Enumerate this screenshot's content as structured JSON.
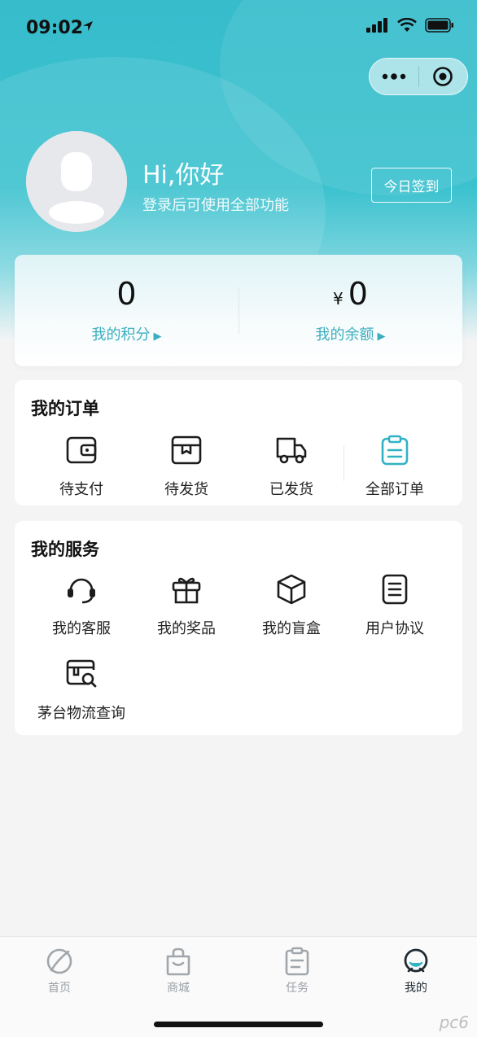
{
  "status_bar": {
    "time": "09:02"
  },
  "profile": {
    "greeting": "Hi,你好",
    "subtitle": "登录后可使用全部功能",
    "checkin_label": "今日签到"
  },
  "stats": {
    "points_value": "0",
    "points_label": "我的积分",
    "balance_currency": "¥",
    "balance_value": "0",
    "balance_label": "我的余额"
  },
  "orders": {
    "title": "我的订单",
    "items": [
      {
        "label": "待支付",
        "icon": "wallet-icon"
      },
      {
        "label": "待发货",
        "icon": "package-icon"
      },
      {
        "label": "已发货",
        "icon": "truck-icon"
      },
      {
        "label": "全部订单",
        "icon": "clipboard-icon"
      }
    ]
  },
  "services": {
    "title": "我的服务",
    "items": [
      {
        "label": "我的客服",
        "icon": "headset-icon"
      },
      {
        "label": "我的奖品",
        "icon": "gift-icon"
      },
      {
        "label": "我的盲盒",
        "icon": "box-icon"
      },
      {
        "label": "用户协议",
        "icon": "document-icon"
      },
      {
        "label": "茅台物流查询",
        "icon": "logistics-search-icon"
      }
    ]
  },
  "tabbar": {
    "tabs": [
      {
        "label": "首页",
        "icon": "home-icon"
      },
      {
        "label": "商城",
        "icon": "shopping-bag-icon"
      },
      {
        "label": "任务",
        "icon": "task-icon"
      },
      {
        "label": "我的",
        "icon": "profile-icon",
        "active": true
      }
    ]
  },
  "watermark": "pc6",
  "colors": {
    "accent": "#3aaebf",
    "hero": "#3cc2cf"
  }
}
